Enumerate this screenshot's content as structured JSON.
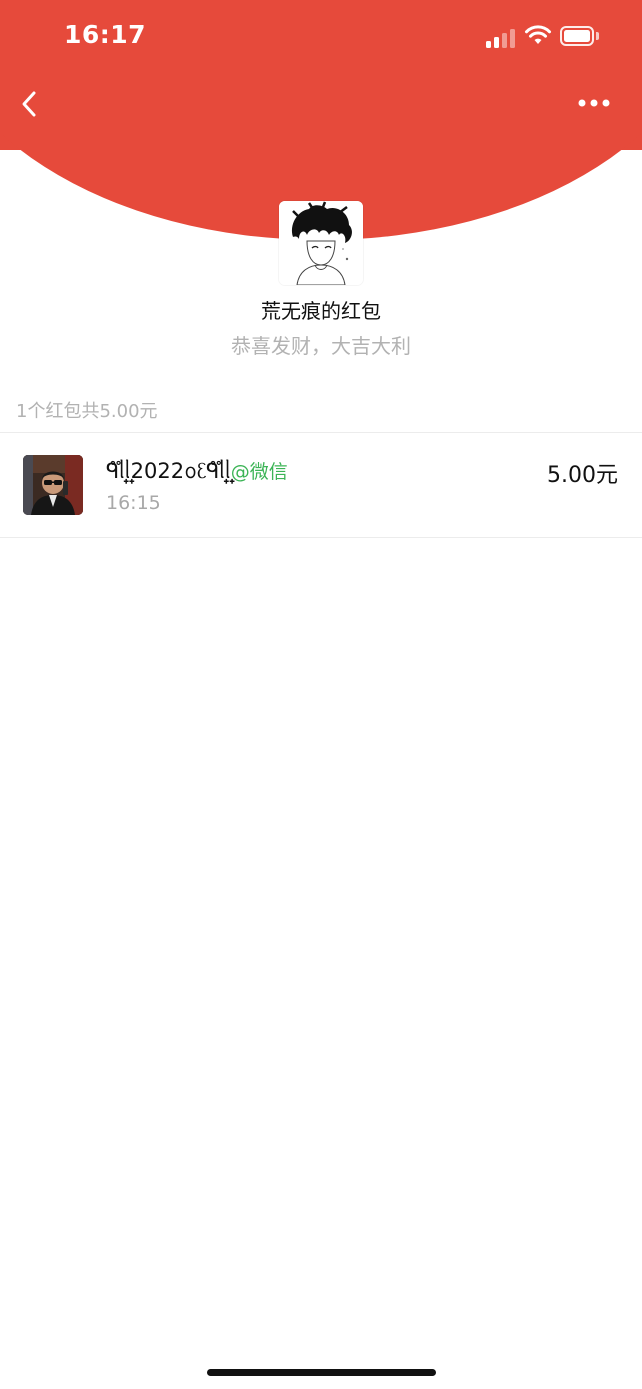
{
  "status_bar": {
    "time": "16:17",
    "signal_icon": "cellular-signal-icon",
    "wifi_icon": "wifi-icon",
    "battery_icon": "battery-icon"
  },
  "nav": {
    "back_icon": "chevron-left-icon",
    "more_icon": "more-dots-icon"
  },
  "sender": {
    "title": "荒无痕的红包",
    "wish": "恭喜发财，大吉大利"
  },
  "summary": {
    "text": "1个红包共5.00元"
  },
  "records": [
    {
      "name": "ᑫ᩠ᩴᥣ᩠ᩴᥣ2022ᩅᦷᑫ᩠ᩴᥣ᩠ᩴᥣ",
      "source": "@微信",
      "time": "16:15",
      "amount": "5.00元"
    }
  ],
  "colors": {
    "header_red": "#e64a3b",
    "source_green": "#3cb456",
    "muted_gray": "#b2b2b2"
  }
}
